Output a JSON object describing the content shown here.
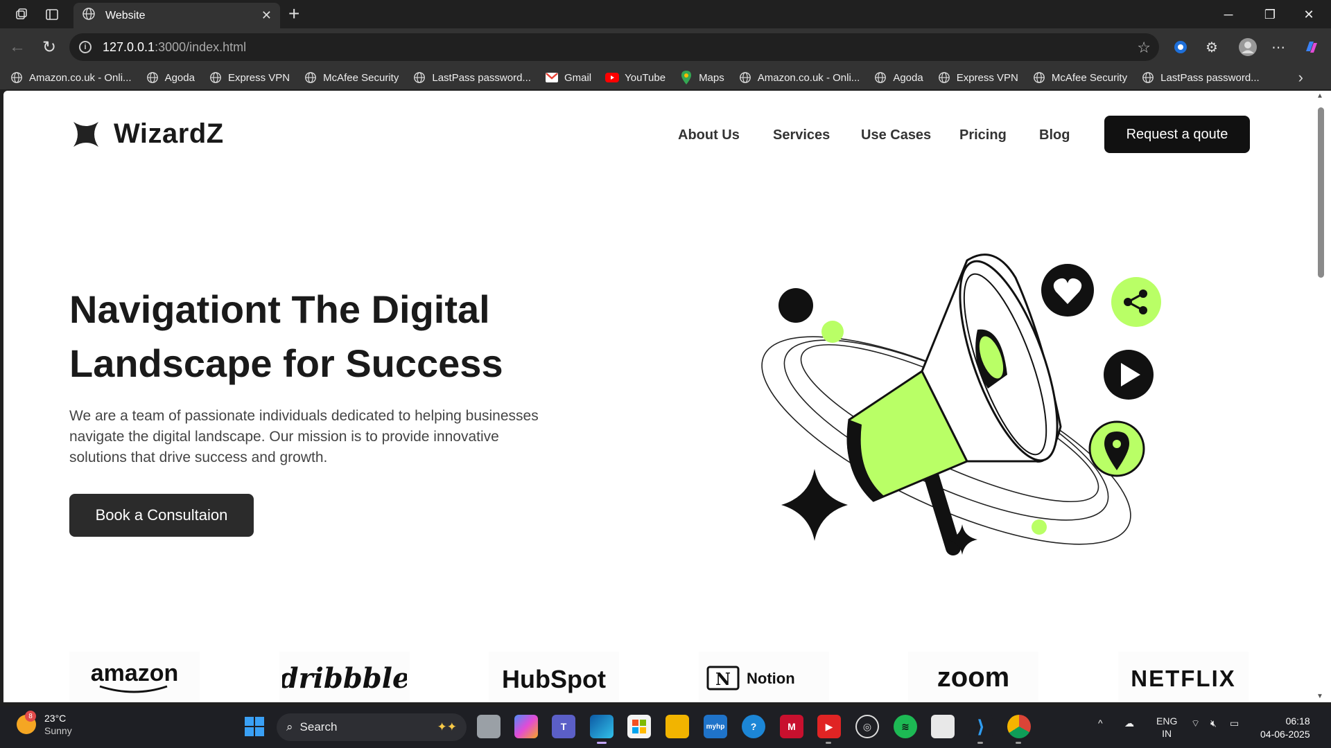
{
  "browser": {
    "tab_title": "Website",
    "url_host": "127.0.0.1",
    "url_path": ":3000/index.html",
    "bookmarks": [
      {
        "label": "Amazon.co.uk - Onli...",
        "icon": "globe-icon"
      },
      {
        "label": "Agoda",
        "icon": "globe-icon"
      },
      {
        "label": "Express VPN",
        "icon": "globe-icon"
      },
      {
        "label": "McAfee Security",
        "icon": "globe-icon"
      },
      {
        "label": "LastPass password...",
        "icon": "globe-icon"
      },
      {
        "label": "Gmail",
        "icon": "gmail-icon"
      },
      {
        "label": "YouTube",
        "icon": "youtube-icon"
      },
      {
        "label": "Maps",
        "icon": "maps-icon"
      },
      {
        "label": "Amazon.co.uk - Onli...",
        "icon": "globe-icon"
      },
      {
        "label": "Agoda",
        "icon": "globe-icon"
      },
      {
        "label": "Express VPN",
        "icon": "globe-icon"
      },
      {
        "label": "McAfee Security",
        "icon": "globe-icon"
      },
      {
        "label": "LastPass password...",
        "icon": "globe-icon"
      }
    ]
  },
  "page": {
    "logo": "WizardZ",
    "nav": [
      "About Us",
      "Services",
      "Use Cases",
      "Pricing",
      "Blog"
    ],
    "cta": "Request a qoute",
    "hero_title": "Navigationt The Digital Landscape for Success",
    "hero_text": "We are a team of passionate individuals dedicated to helping businesses navigate the digital landscape. Our mission is to provide innovative solutions that drive success and growth.",
    "hero_button": "Book a Consultaion",
    "accent_color": "#B9FF66",
    "brands": [
      "amazon",
      "dribbble",
      "HubSpot",
      "Notion",
      "zoom",
      "NETFLIX"
    ]
  },
  "taskbar": {
    "weather_temp": "23°C",
    "weather_desc": "Sunny",
    "weather_badge": "8",
    "search_label": "Search",
    "lang_1": "ENG",
    "lang_2": "IN",
    "time": "06:18",
    "date": "04-06-2025"
  }
}
